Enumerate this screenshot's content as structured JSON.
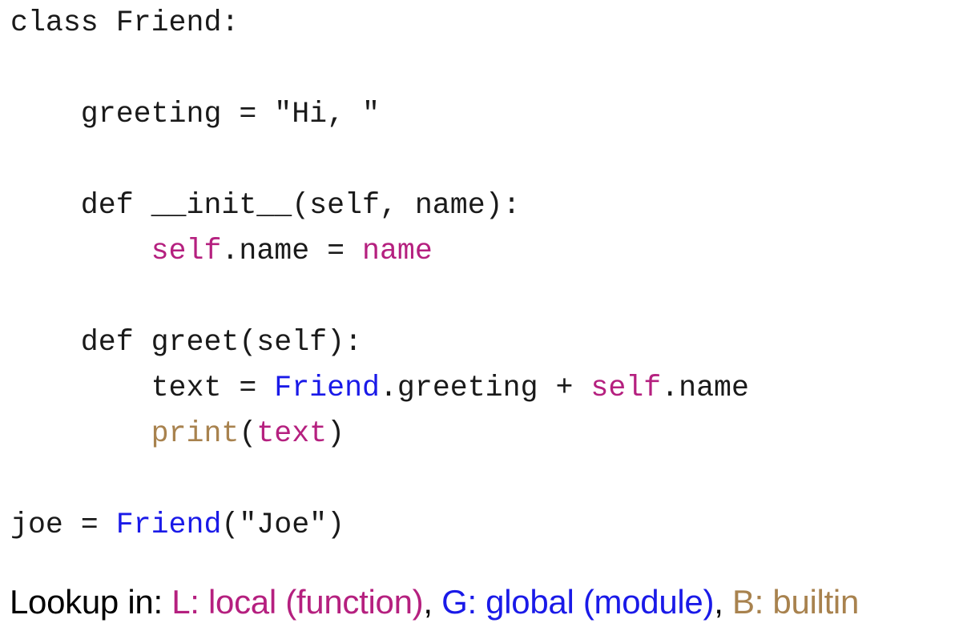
{
  "colors": {
    "default": "#1a1a1a",
    "local": "#b5207f",
    "global": "#1a1ae8",
    "builtin": "#a8824e"
  },
  "code_lines": [
    {
      "tokens": [
        {
          "text": "class Friend:",
          "kind": "default"
        }
      ]
    },
    {
      "tokens": []
    },
    {
      "tokens": [
        {
          "text": "    greeting = \"Hi, \"",
          "kind": "default"
        }
      ]
    },
    {
      "tokens": []
    },
    {
      "tokens": [
        {
          "text": "    def __init__(self, name):",
          "kind": "default"
        }
      ]
    },
    {
      "tokens": [
        {
          "text": "        ",
          "kind": "default"
        },
        {
          "text": "self",
          "kind": "local"
        },
        {
          "text": ".name = ",
          "kind": "default"
        },
        {
          "text": "name",
          "kind": "local"
        }
      ]
    },
    {
      "tokens": []
    },
    {
      "tokens": [
        {
          "text": "    def greet(self):",
          "kind": "default"
        }
      ]
    },
    {
      "tokens": [
        {
          "text": "        text = ",
          "kind": "default"
        },
        {
          "text": "Friend",
          "kind": "global"
        },
        {
          "text": ".greeting + ",
          "kind": "default"
        },
        {
          "text": "self",
          "kind": "local"
        },
        {
          "text": ".name",
          "kind": "default"
        }
      ]
    },
    {
      "tokens": [
        {
          "text": "        ",
          "kind": "default"
        },
        {
          "text": "print",
          "kind": "builtin"
        },
        {
          "text": "(",
          "kind": "default"
        },
        {
          "text": "text",
          "kind": "local"
        },
        {
          "text": ")",
          "kind": "default"
        }
      ]
    },
    {
      "tokens": []
    },
    {
      "tokens": [
        {
          "text": "joe = ",
          "kind": "default"
        },
        {
          "text": "Friend",
          "kind": "global"
        },
        {
          "text": "(\"Joe\")",
          "kind": "default"
        }
      ]
    }
  ],
  "legend": {
    "prefix": "Lookup in: ",
    "local": "L: local (function)",
    "sep1": ", ",
    "global": "G: global (module)",
    "sep2": ", ",
    "builtin": "B: builtin"
  }
}
